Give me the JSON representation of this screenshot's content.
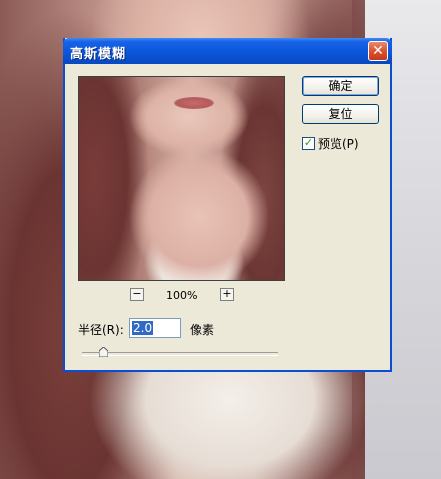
{
  "window": {
    "title": "高斯模糊",
    "close_glyph": "✕"
  },
  "buttons": {
    "ok": "确定",
    "reset": "复位"
  },
  "preview_option": {
    "label": "预览(P)",
    "checked": true
  },
  "zoom": {
    "out_glyph": "−",
    "in_glyph": "+",
    "level": "100%"
  },
  "radius": {
    "label": "半径(R):",
    "value": "2.0",
    "unit": "像素",
    "slider_level": 0.08
  },
  "colors": {
    "titlebar": "#0a55d8",
    "dialog_bg": "#ece9d8",
    "selection": "#316ac5"
  }
}
